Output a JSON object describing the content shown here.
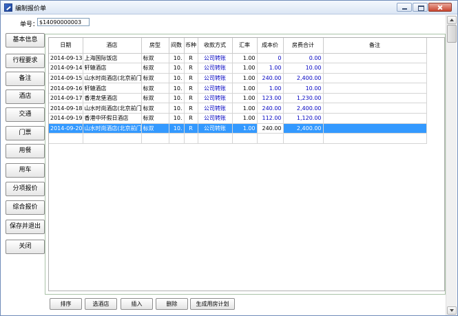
{
  "window": {
    "title": "编制报价单"
  },
  "form": {
    "no_label": "单号：",
    "no_value": "$14090000003"
  },
  "sidebar": {
    "items": [
      {
        "label": "基本信息"
      },
      {
        "label": "行程要求"
      },
      {
        "label": "备注"
      },
      {
        "label": "酒店"
      },
      {
        "label": "交通"
      },
      {
        "label": "门票"
      },
      {
        "label": "用餐"
      },
      {
        "label": "用车"
      },
      {
        "label": "分项报价"
      },
      {
        "label": "综合报价"
      },
      {
        "label": "保存并退出"
      },
      {
        "label": "关闭"
      }
    ]
  },
  "table": {
    "columns": [
      "日期",
      "酒店",
      "房型",
      "间数",
      "币种",
      "收款方式",
      "汇率",
      "成本价",
      "房费合计",
      "备注"
    ],
    "rows": [
      [
        "2014-09-13",
        "上海国际饭店",
        "标双",
        "10.",
        "R",
        "公司转账",
        "1.00",
        "0",
        "0.00",
        ""
      ],
      [
        "2014-09-14",
        "轩辕酒店",
        "标双",
        "10.",
        "R",
        "公司转账",
        "1.00",
        "1.00",
        "10.00",
        ""
      ],
      [
        "2014-09-15",
        "山水时尚酒店(北京前门店)",
        "标双",
        "10.",
        "R",
        "公司转账",
        "1.00",
        "240.00",
        "2,400.00",
        ""
      ],
      [
        "2014-09-16",
        "轩辕酒店",
        "标双",
        "10.",
        "R",
        "公司转账",
        "1.00",
        "1.00",
        "10.00",
        ""
      ],
      [
        "2014-09-17",
        "香港龙堡酒店",
        "标双",
        "10.",
        "R",
        "公司转账",
        "1.00",
        "123.00",
        "1,230.00",
        ""
      ],
      [
        "2014-09-18",
        "山水时尚酒店(北京前门店)",
        "标双",
        "10.",
        "R",
        "公司转账",
        "1.00",
        "240.00",
        "2,400.00",
        ""
      ],
      [
        "2014-09-19",
        "香港中环假日酒店",
        "标双",
        "10.",
        "R",
        "公司转账",
        "1.00",
        "112.00",
        "1,120.00",
        ""
      ],
      [
        "2014-09-20",
        "山水时尚酒店(北京前门店)",
        "标双",
        "10.",
        "R",
        "公司转账",
        "1.00",
        "240.00",
        "2,400.00",
        ""
      ]
    ],
    "selected_row": 7
  },
  "bottom_buttons": [
    {
      "label": "排序"
    },
    {
      "label": "选酒店"
    },
    {
      "label": "插入"
    },
    {
      "label": "删除"
    },
    {
      "label": "生成用房计划"
    }
  ]
}
